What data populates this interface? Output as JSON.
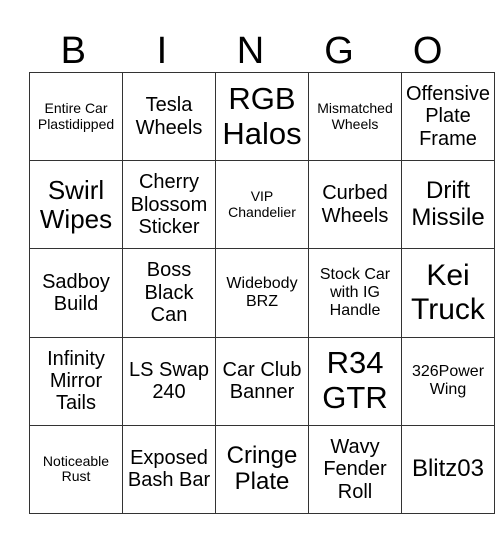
{
  "header": [
    "B",
    "I",
    "N",
    "G",
    "O"
  ],
  "rows": [
    [
      "Entire Car Plastidipped",
      "Tesla Wheels",
      "RGB Halos",
      "Mismatched Wheels",
      "Offensive Plate Frame"
    ],
    [
      "Swirl Wipes",
      "Cherry Blossom Sticker",
      "VIP Chandelier",
      "Curbed Wheels",
      "Drift Missile"
    ],
    [
      "Sadboy Build",
      "Boss Black Can",
      "Widebody BRZ",
      "Stock Car with IG Handle",
      "Kei Truck"
    ],
    [
      "Infinity Mirror Tails",
      "LS Swap 240",
      "Car Club Banner",
      "R34 GTR",
      "326Power Wing"
    ],
    [
      "Noticeable Rust",
      "Exposed Bash Bar",
      "Cringe Plate",
      "Wavy Fender Roll",
      "Blitz03"
    ]
  ]
}
